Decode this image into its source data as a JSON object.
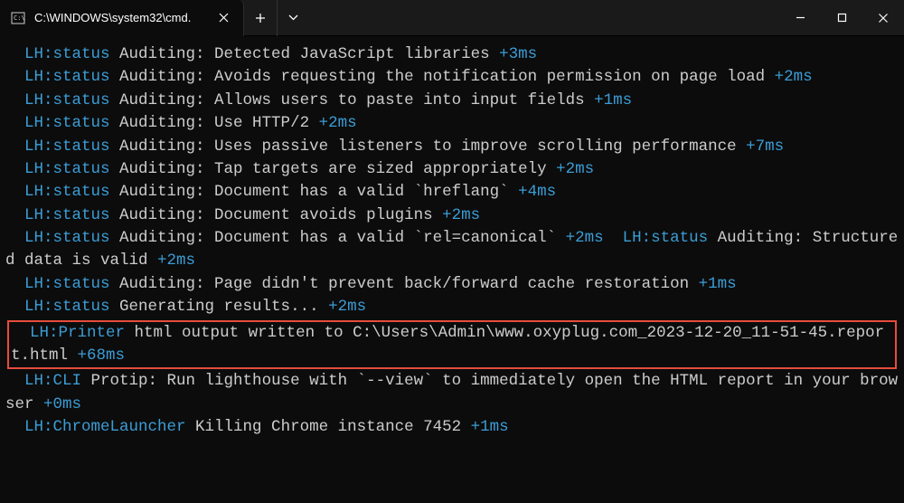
{
  "titlebar": {
    "tab_title": "C:\\WINDOWS\\system32\\cmd.",
    "new_tab_icon": "plus",
    "dropdown_icon": "chevron-down"
  },
  "terminal": {
    "lines": [
      {
        "tag": "LH:status",
        "text": " Auditing: Detected JavaScript libraries ",
        "timing": "+3ms",
        "indent": true
      },
      {
        "tag": "LH:status",
        "text": " Auditing: Avoids requesting the notification permission on page load ",
        "timing": "+2ms",
        "indent": true,
        "wrap": true
      },
      {
        "tag": "LH:status",
        "text": " Auditing: Allows users to paste into input fields ",
        "timing": "+1ms",
        "indent": true
      },
      {
        "tag": "LH:status",
        "text": " Auditing: Use HTTP/2 ",
        "timing": "+2ms",
        "indent": true
      },
      {
        "tag": "LH:status",
        "text": " Auditing: Uses passive listeners to improve scrolling performance ",
        "timing": "+7ms",
        "indent": true,
        "wrap": true
      },
      {
        "tag": "LH:status",
        "text": " Auditing: Tap targets are sized appropriately ",
        "timing": "+2ms",
        "indent": true
      },
      {
        "tag": "LH:status",
        "text": " Auditing: Document has a valid `hreflang` ",
        "timing": "+4ms",
        "indent": true
      },
      {
        "tag": "LH:status",
        "text": " Auditing: Document avoids plugins ",
        "timing": "+2ms",
        "indent": true
      },
      {
        "tag": "LH:status",
        "text": " Auditing: Document has a valid `rel=canonical` ",
        "timing": "+2ms",
        "tag2": "LH:status",
        "text2": " Auditing: Structured data is valid ",
        "timing2": "+2ms",
        "indent": true,
        "double": true
      },
      {
        "tag": "LH:status",
        "text": " Auditing: Page didn't prevent back/forward cache restoration ",
        "timing": "+1ms",
        "indent": true
      },
      {
        "tag": "LH:status",
        "text": " Generating results... ",
        "timing": "+2ms",
        "indent": true
      },
      {
        "tag": "LH:Printer",
        "text": " html output written to C:\\Users\\Admin\\www.oxyplug.com_2023-12-20_11-51-45.report.html ",
        "timing": "+68ms",
        "indent": true,
        "highlighted": true,
        "wrap": true
      },
      {
        "tag": "LH:CLI",
        "text": " Protip: Run lighthouse with `--view` to immediately open the HTML report in your browser ",
        "timing": "+0ms",
        "indent": true,
        "wrap": true
      },
      {
        "tag": "LH:ChromeLauncher",
        "text": " Killing Chrome instance 7452 ",
        "timing": "+1ms",
        "indent": true
      }
    ]
  }
}
